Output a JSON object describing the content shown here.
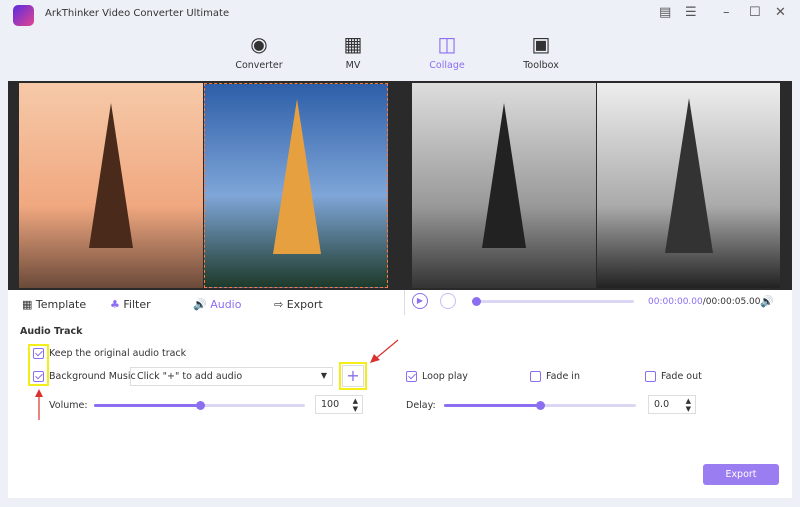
{
  "app": {
    "title": "ArkThinker Video Converter Ultimate"
  },
  "nav": [
    {
      "label": "Converter",
      "icon": "converter-icon"
    },
    {
      "label": "MV",
      "icon": "mv-icon"
    },
    {
      "label": "Collage",
      "icon": "collage-icon",
      "active": true
    },
    {
      "label": "Toolbox",
      "icon": "toolbox-icon"
    }
  ],
  "tabs": [
    {
      "label": "Template"
    },
    {
      "label": "Filter"
    },
    {
      "label": "Audio",
      "active": true
    },
    {
      "label": "Export"
    }
  ],
  "player": {
    "current": "00:00:00.00",
    "total": "/00:00:05.00",
    "progress": 0
  },
  "audio": {
    "heading": "Audio Track",
    "keep_original": {
      "label": "Keep the original audio track",
      "checked": true
    },
    "background_music": {
      "label": "Background Music",
      "checked": true,
      "placeholder": "Click \"+\" to add audio"
    },
    "loop_play": {
      "label": "Loop play",
      "checked": true
    },
    "fade_in": {
      "label": "Fade in",
      "checked": false
    },
    "fade_out": {
      "label": "Fade out",
      "checked": false
    },
    "volume": {
      "label": "Volume:",
      "value": "100",
      "level_percent": 50
    },
    "delay": {
      "label": "Delay:",
      "value": "0.0",
      "level_percent": 50
    },
    "add": "+"
  },
  "export_button": "Export",
  "colors": {
    "accent": "#8c6ef0",
    "highlight": "#f3ee1a",
    "arrow": "#d9322e"
  }
}
